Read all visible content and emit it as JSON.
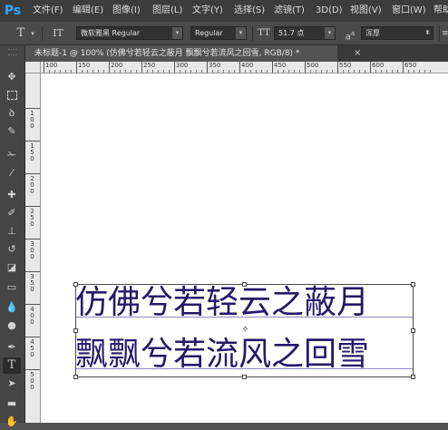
{
  "app": {
    "logo": "Ps",
    "menu": [
      "文件(F)",
      "编辑(E)",
      "图像(I)",
      "图层(L)",
      "文字(Y)",
      "选择(S)",
      "滤镜(T)",
      "3D(D)",
      "视图(V)",
      "窗口(W)",
      "帮助"
    ]
  },
  "options": {
    "tool_glyph": "T",
    "orient_glyph": "IT",
    "font_family": "微软雅黑 Regular",
    "font_style": "Regular",
    "size_glyph": "TT",
    "font_size": "51.7 点",
    "aa_glyph": "a",
    "aa_sub": "a",
    "anti_alias": "浑厚"
  },
  "document": {
    "tab_title": "未标题-1 @ 100% (仿佛兮若轻云之蔽月  飘飘兮若流风之回雪, RGB/8) *",
    "close_glyph": "×"
  },
  "ruler": {
    "top_labels": [
      "100",
      "150",
      "200",
      "250",
      "300",
      "350",
      "400",
      "450",
      "500",
      "550",
      "600",
      "650"
    ],
    "left_labels": [
      "1\n0\n0",
      "1\n5\n0",
      "2\n0\n0",
      "2\n5\n0",
      "3\n0\n0",
      "3\n5\n0",
      "4\n0\n0",
      "4\n5\n0",
      "5\n0\n0"
    ]
  },
  "canvas_text": {
    "line1": "仿佛兮若轻云之蔽月",
    "line2": "飘飘兮若流风之回雪"
  },
  "colors": {
    "text": "#26186b",
    "ps_blue": "#31a8ff"
  },
  "tools": [
    "move-icon",
    "marquee-icon",
    "lasso-icon",
    "quick-select-icon",
    "crop-icon",
    "eyedropper-icon",
    "healing-icon",
    "brush-icon",
    "stamp-icon",
    "history-brush-icon",
    "eraser-icon",
    "gradient-icon",
    "blur-icon",
    "dodge-icon",
    "pen-icon",
    "type-icon",
    "path-select-icon",
    "shape-icon"
  ]
}
